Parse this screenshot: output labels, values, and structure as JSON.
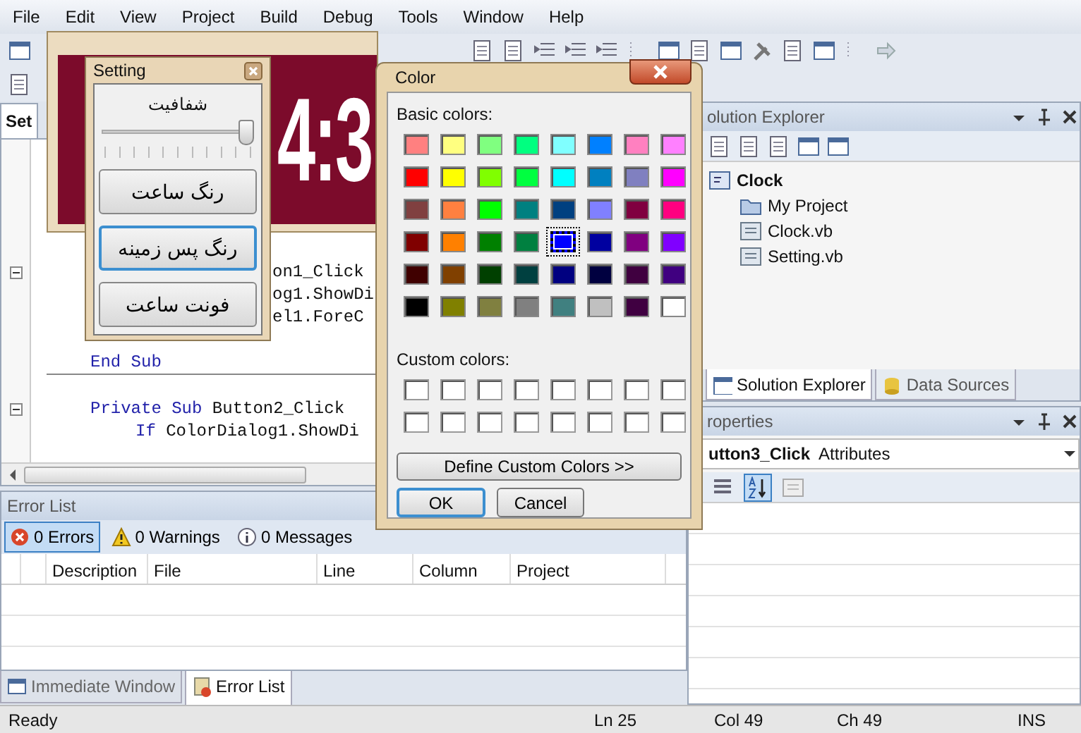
{
  "menu": [
    "File",
    "Edit",
    "View",
    "Project",
    "Build",
    "Debug",
    "Tools",
    "Window",
    "Help"
  ],
  "document_tab": {
    "label": "Set",
    "selected": true
  },
  "code": {
    "partly_hidden_lines": [
      {
        "segments": [
          {
            "text": "on1_Click",
            "kind": "plain"
          }
        ],
        "collapsible": true
      },
      {
        "segments": [
          {
            "text": "og1.ShowDi",
            "kind": "plain"
          }
        ],
        "collapsible": false
      },
      {
        "segments": [
          {
            "text": "el1.ForeC",
            "kind": "plain"
          }
        ],
        "collapsible": false
      }
    ],
    "lines": [
      {
        "kind": "code",
        "segments": [
          {
            "text": "End Sub",
            "kind": "keyword"
          }
        ],
        "collapsible": false
      },
      {
        "kind": "separator"
      },
      {
        "kind": "code",
        "segments": [
          {
            "text": "Private Sub ",
            "kind": "keyword"
          },
          {
            "text": "Button2_Click",
            "kind": "plain"
          }
        ],
        "collapsible": true,
        "children": [
          {
            "kind": "code",
            "segments": [
              {
                "text": "If ",
                "kind": "keyword"
              },
              {
                "text": "ColorDialog1.ShowDi",
                "kind": "plain"
              }
            ],
            "collapsible": false
          }
        ]
      }
    ]
  },
  "clock_form": {
    "display": "4:3"
  },
  "setting_window": {
    "title": "Setting",
    "opacity_label": "شفافیت",
    "opacity_slider": {
      "level": 1.0
    },
    "buttons": [
      {
        "label": "رنگ ساعت",
        "selected": false
      },
      {
        "label": "رنگ پس زمینه",
        "selected": true
      },
      {
        "label": "فونت ساعت",
        "selected": false
      }
    ]
  },
  "color_dialog": {
    "title": "Color",
    "basic_label": "Basic colors:",
    "basic_colors": [
      {
        "color": "#ff8080",
        "selected": false
      },
      {
        "color": "#ffff80",
        "selected": false
      },
      {
        "color": "#80ff80",
        "selected": false
      },
      {
        "color": "#00ff80",
        "selected": false
      },
      {
        "color": "#80ffff",
        "selected": false
      },
      {
        "color": "#0080ff",
        "selected": false
      },
      {
        "color": "#ff80c0",
        "selected": false
      },
      {
        "color": "#ff80ff",
        "selected": false
      },
      {
        "color": "#ff0000",
        "selected": false
      },
      {
        "color": "#ffff00",
        "selected": false
      },
      {
        "color": "#80ff00",
        "selected": false
      },
      {
        "color": "#00ff40",
        "selected": false
      },
      {
        "color": "#00ffff",
        "selected": false
      },
      {
        "color": "#0080c0",
        "selected": false
      },
      {
        "color": "#8080c0",
        "selected": false
      },
      {
        "color": "#ff00ff",
        "selected": false
      },
      {
        "color": "#804040",
        "selected": false
      },
      {
        "color": "#ff8040",
        "selected": false
      },
      {
        "color": "#00ff00",
        "selected": false
      },
      {
        "color": "#008080",
        "selected": false
      },
      {
        "color": "#004080",
        "selected": false
      },
      {
        "color": "#8080ff",
        "selected": false
      },
      {
        "color": "#800040",
        "selected": false
      },
      {
        "color": "#ff0080",
        "selected": false
      },
      {
        "color": "#800000",
        "selected": false
      },
      {
        "color": "#ff8000",
        "selected": false
      },
      {
        "color": "#008000",
        "selected": false
      },
      {
        "color": "#008040",
        "selected": false
      },
      {
        "color": "#0000ff",
        "selected": true
      },
      {
        "color": "#0000a0",
        "selected": false
      },
      {
        "color": "#800080",
        "selected": false
      },
      {
        "color": "#8000ff",
        "selected": false
      },
      {
        "color": "#400000",
        "selected": false
      },
      {
        "color": "#804000",
        "selected": false
      },
      {
        "color": "#004000",
        "selected": false
      },
      {
        "color": "#004040",
        "selected": false
      },
      {
        "color": "#000080",
        "selected": false
      },
      {
        "color": "#000040",
        "selected": false
      },
      {
        "color": "#400040",
        "selected": false
      },
      {
        "color": "#400080",
        "selected": false
      },
      {
        "color": "#000000",
        "selected": false
      },
      {
        "color": "#808000",
        "selected": false
      },
      {
        "color": "#808040",
        "selected": false
      },
      {
        "color": "#808080",
        "selected": false
      },
      {
        "color": "#408080",
        "selected": false
      },
      {
        "color": "#c0c0c0",
        "selected": false
      },
      {
        "color": "#400041",
        "selected": false
      },
      {
        "color": "#ffffff",
        "selected": false
      }
    ],
    "custom_label": "Custom colors:",
    "custom_colors": [
      {
        "color": "#ffffff"
      },
      {
        "color": "#ffffff"
      },
      {
        "color": "#ffffff"
      },
      {
        "color": "#ffffff"
      },
      {
        "color": "#ffffff"
      },
      {
        "color": "#ffffff"
      },
      {
        "color": "#ffffff"
      },
      {
        "color": "#ffffff"
      },
      {
        "color": "#ffffff"
      },
      {
        "color": "#ffffff"
      },
      {
        "color": "#ffffff"
      },
      {
        "color": "#ffffff"
      },
      {
        "color": "#ffffff"
      },
      {
        "color": "#ffffff"
      },
      {
        "color": "#ffffff"
      },
      {
        "color": "#ffffff"
      }
    ],
    "define_button": "Define Custom Colors >>",
    "ok_button": {
      "label": "OK",
      "default": true
    },
    "cancel_button": "Cancel"
  },
  "solution_explorer": {
    "title": "olution Explorer",
    "tree": [
      {
        "label": "Clock",
        "kind": "project",
        "children": [
          {
            "label": "My Project",
            "kind": "folder"
          },
          {
            "label": "Clock.vb",
            "kind": "form"
          },
          {
            "label": "Setting.vb",
            "kind": "form"
          }
        ]
      }
    ],
    "tabs": [
      {
        "label": "Solution Explorer",
        "selected": true
      },
      {
        "label": "Data Sources",
        "selected": false
      }
    ]
  },
  "properties": {
    "title": "roperties",
    "object": "utton3_Click",
    "object_type": "Attributes",
    "view_buttons": [
      {
        "kind": "categorized",
        "selected": false
      },
      {
        "kind": "alphabetical",
        "selected": true
      },
      {
        "kind": "pages",
        "selected": false
      }
    ]
  },
  "error_list": {
    "title": "Error List",
    "filters": [
      {
        "label": "0 Errors",
        "kind": "error",
        "selected": true
      },
      {
        "label": "0 Warnings",
        "kind": "warning",
        "selected": false
      },
      {
        "label": "0 Messages",
        "kind": "info",
        "selected": false
      }
    ],
    "columns": [
      "Description",
      "File",
      "Line",
      "Column",
      "Project"
    ]
  },
  "bottom_tabs": [
    {
      "label": "Immediate Window",
      "kind": "immediate",
      "selected": false
    },
    {
      "label": "Error List",
      "kind": "errors",
      "selected": true
    }
  ],
  "status_bar": {
    "message": "Ready",
    "line": "Ln 25",
    "column": "Col 49",
    "char": "Ch 49",
    "mode": "INS"
  }
}
